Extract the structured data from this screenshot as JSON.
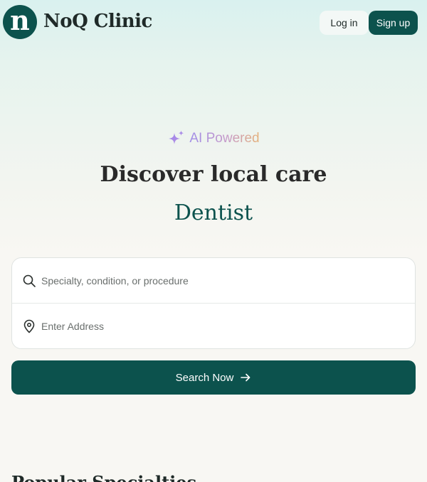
{
  "brand": {
    "logo_letter": "n",
    "name": "NoQ Clinic",
    "color": "#0c524d"
  },
  "header": {
    "login_label": "Log in",
    "signup_label": "Sign up"
  },
  "hero": {
    "badge_icon": "sparkle-icon",
    "badge_text": "AI Powered",
    "headline": "Discover local care",
    "rotating_specialty": "Dentist"
  },
  "search": {
    "specialty_placeholder": "Specialty, condition, or procedure",
    "specialty_icon": "search-icon",
    "address_placeholder": "Enter Address",
    "address_icon": "map-pin-icon",
    "submit_label": "Search Now",
    "submit_icon": "arrow-right-icon"
  },
  "sections": {
    "popular_title": "Popular Specialties"
  }
}
